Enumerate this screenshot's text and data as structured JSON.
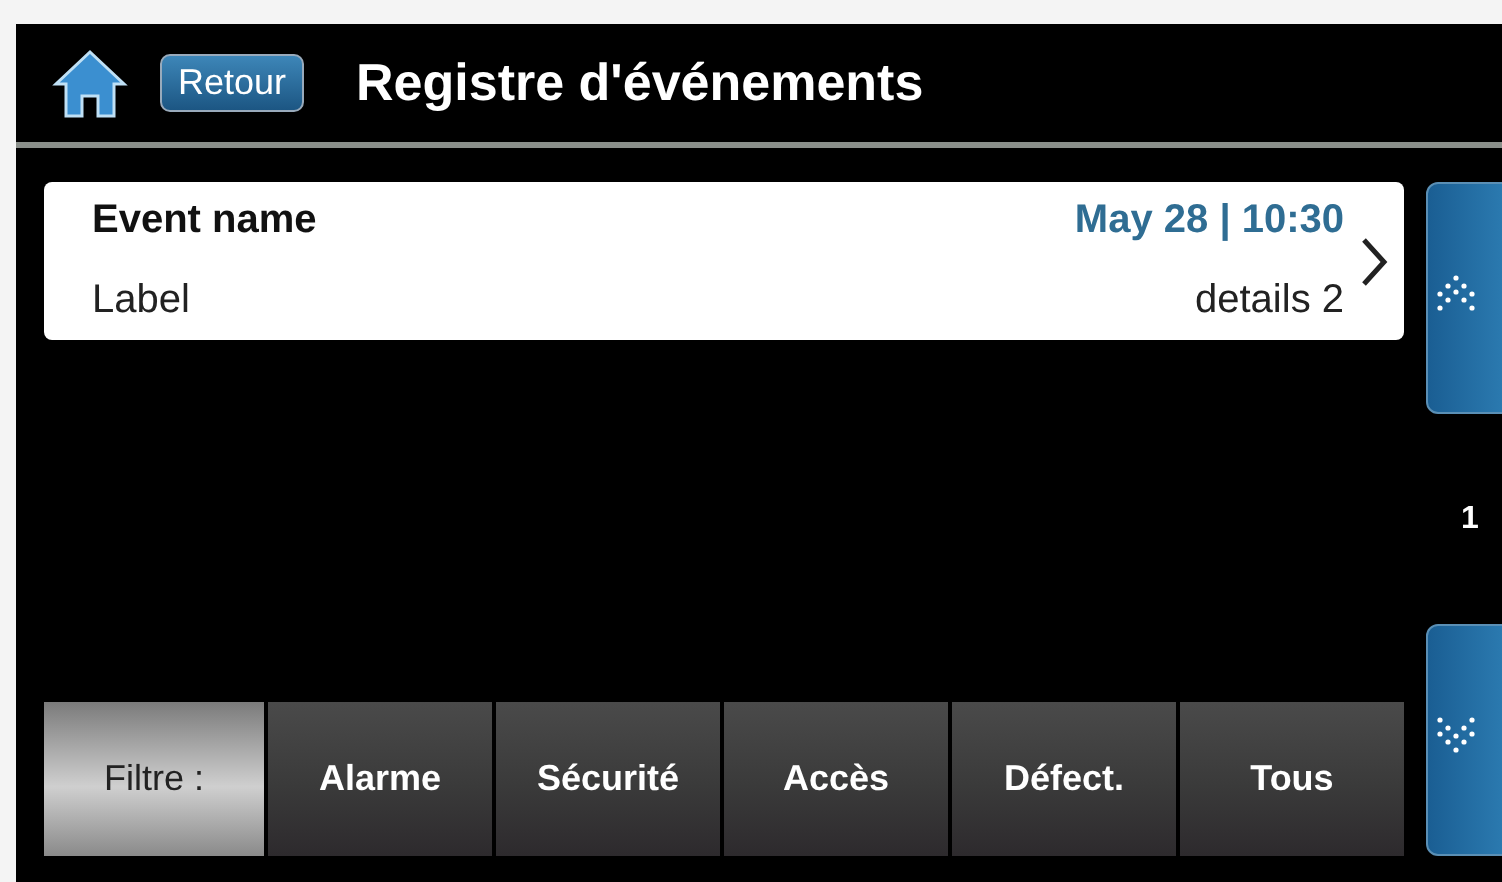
{
  "header": {
    "back_button": "Retour",
    "title": "Registre d'événements"
  },
  "events": [
    {
      "name": "Event name",
      "date": "May 28 | 10:30",
      "label": "Label",
      "details": "details 2"
    }
  ],
  "pager": {
    "page": "1"
  },
  "filter": {
    "label": "Filtre :",
    "options": [
      {
        "label": "Alarme",
        "selected": false
      },
      {
        "label": "Sécurité",
        "selected": false
      },
      {
        "label": "Accès",
        "selected": false
      },
      {
        "label": "Défect.",
        "selected": false
      },
      {
        "label": "Tous",
        "selected": false
      }
    ]
  }
}
